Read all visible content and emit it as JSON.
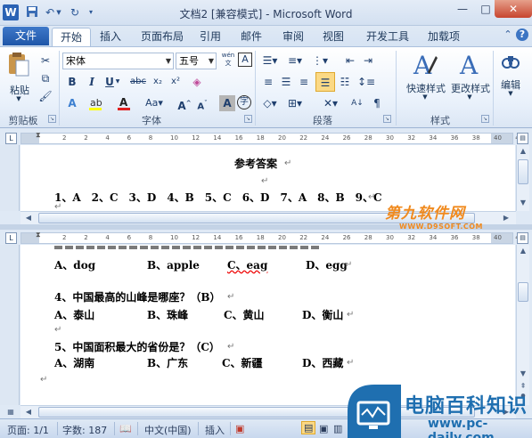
{
  "window": {
    "title": "文档2 [兼容模式] - Microsoft Word",
    "app_icon_letter": "W"
  },
  "tabs": {
    "file": "文件",
    "items": [
      "开始",
      "插入",
      "页面布局",
      "引用",
      "邮件",
      "审阅",
      "视图",
      "开发工具",
      "加载项"
    ],
    "active": "开始"
  },
  "ribbon": {
    "clipboard": {
      "paste": "粘贴",
      "group": "剪贴板"
    },
    "font": {
      "name": "宋体",
      "size": "五号",
      "wen_icon": "wén",
      "group": "字体"
    },
    "paragraph": {
      "group": "段落"
    },
    "styles": {
      "quick": "快速样式",
      "change": "更改样式",
      "group": "样式"
    },
    "editing": {
      "label": "编辑"
    }
  },
  "ruler": {
    "ticks": [
      "2",
      "2",
      "4",
      "6",
      "8",
      "10",
      "12",
      "14",
      "16",
      "18",
      "20",
      "22",
      "24",
      "26",
      "28",
      "30",
      "32",
      "34",
      "36",
      "38",
      "40",
      "42"
    ]
  },
  "doc": {
    "pane1": {
      "title": "参考答案",
      "answers": "1、A　2、C　3、D　4、B　5、C　6、D　7、A　8、B　9、C"
    },
    "pane2": {
      "q3_options": [
        "A、dog",
        "B、apple",
        "C、eag",
        "D、egg"
      ],
      "q4": "4、中国最高的山峰是哪座？（B）",
      "q4_options": [
        "A、泰山",
        "B、珠峰",
        "C、黄山",
        "D、衡山"
      ],
      "q5": "5、中国面积最大的省份是？（C）",
      "q5_options": [
        "A、湖南",
        "B、广东",
        "C、新疆",
        "D、西藏"
      ]
    }
  },
  "status": {
    "page": "页面: 1/1",
    "words": "字数: 187",
    "language": "中文(中国)",
    "mode": "插入"
  },
  "watermarks": {
    "site1": "第九软件网",
    "site1_url": "WWW.D9SOFT.COM",
    "site2": "电脑百科知识",
    "site2_url": "www.pc-daily.com"
  },
  "colors": {
    "file_tab": "#2a62b4",
    "watermark1": "#f08a1e",
    "watermark2_bg": "#1f6fb0"
  }
}
